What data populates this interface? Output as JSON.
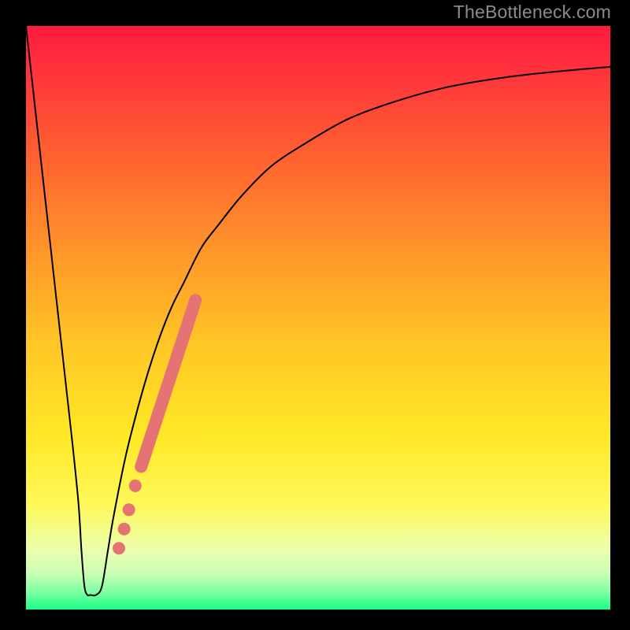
{
  "watermark": "TheBottleneck.com",
  "chart_data": {
    "type": "line",
    "title": "",
    "xlabel": "",
    "ylabel": "",
    "xlim": [
      0,
      100
    ],
    "ylim": [
      0,
      100
    ],
    "background_gradient": {
      "stops": [
        {
          "offset": 0.0,
          "color": "#ff1a3f"
        },
        {
          "offset": 0.1,
          "color": "#ff3a3a"
        },
        {
          "offset": 0.25,
          "color": "#ff6a2f"
        },
        {
          "offset": 0.4,
          "color": "#ff9a2a"
        },
        {
          "offset": 0.55,
          "color": "#ffc726"
        },
        {
          "offset": 0.7,
          "color": "#ffe825"
        },
        {
          "offset": 0.82,
          "color": "#fff85a"
        },
        {
          "offset": 0.9,
          "color": "#ecffb0"
        },
        {
          "offset": 0.94,
          "color": "#c7ffb4"
        },
        {
          "offset": 0.97,
          "color": "#7cffa3"
        },
        {
          "offset": 1.0,
          "color": "#1aff86"
        }
      ]
    },
    "series": [
      {
        "name": "bottleneck-curve",
        "color": "#000000",
        "stroke_width": 2,
        "x": [
          0,
          2,
          4,
          6,
          7,
          8,
          9,
          9.5,
          10,
          10.5,
          11,
          12,
          13,
          14,
          15,
          17,
          19,
          21,
          23,
          25,
          27,
          30,
          33,
          37,
          42,
          48,
          55,
          63,
          72,
          82,
          92,
          100
        ],
        "y": [
          100,
          82,
          64,
          46,
          37,
          28,
          18,
          10,
          4,
          2.5,
          2.5,
          2.5,
          4,
          10,
          16,
          26,
          34,
          41,
          47,
          52,
          56,
          62,
          66,
          71,
          76,
          80,
          84,
          87,
          89.5,
          91.2,
          92.3,
          93
        ]
      }
    ],
    "highlight_segment": {
      "name": "highlighted-range",
      "color": "#e57373",
      "stroke_width": 16,
      "x": [
        19.7,
        29.0
      ],
      "y": [
        24.5,
        53.0
      ]
    },
    "highlight_dots": {
      "name": "highlight-dots",
      "color": "#e57373",
      "radius": 8,
      "points": [
        {
          "x": 18.7,
          "y": 21.2
        },
        {
          "x": 17.6,
          "y": 17.1
        },
        {
          "x": 16.8,
          "y": 13.8
        },
        {
          "x": 15.9,
          "y": 10.5
        }
      ]
    }
  }
}
